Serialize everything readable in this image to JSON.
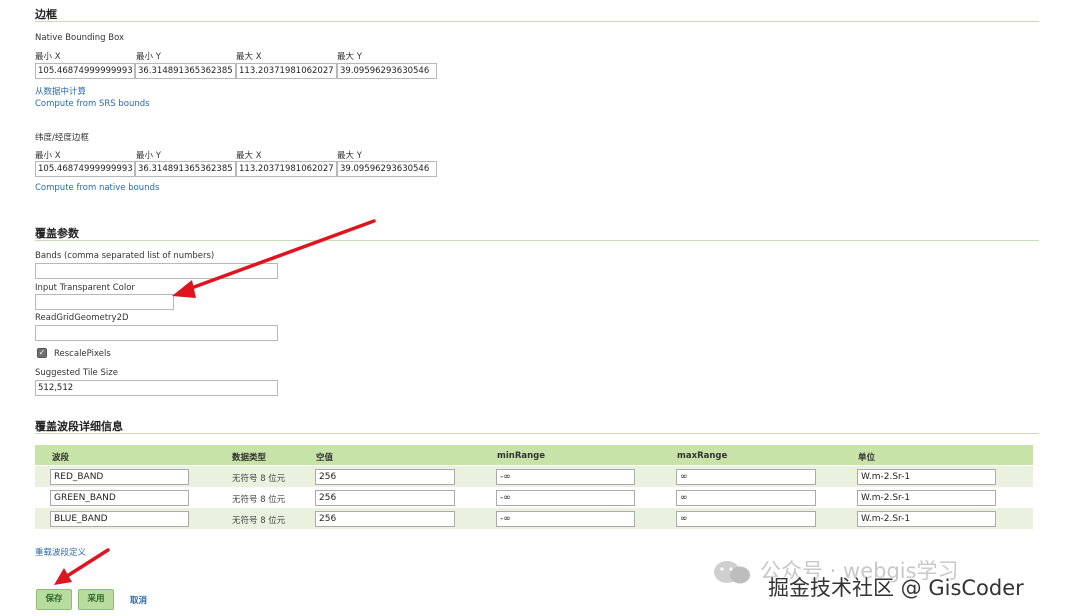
{
  "bbox_section": {
    "title": "边框",
    "native": {
      "label": "Native Bounding Box",
      "headers": [
        "最小 X",
        "最小 Y",
        "最大 X",
        "最大 Y"
      ],
      "values": [
        "105.46874999999993",
        "36.314891365362385",
        "113.20371981062027",
        "39.09596293630546"
      ],
      "link_compute_data": "从数据中计算",
      "link_compute_srs": "Compute from SRS bounds"
    },
    "latlon": {
      "label": "纬度/经度边框",
      "headers": [
        "最小 X",
        "最小 Y",
        "最大 X",
        "最大 Y"
      ],
      "values": [
        "105.46874999999993",
        "36.314891365362385",
        "113.20371981062027",
        "39.09596293630546"
      ],
      "link_compute_native": "Compute from native bounds"
    }
  },
  "coverage_params": {
    "title": "覆盖参数",
    "bands_label": "Bands (comma separated list of numbers)",
    "bands_value": "",
    "transparent_label": "Input Transparent Color",
    "transparent_value": "",
    "readgrid_label": "ReadGridGeometry2D",
    "readgrid_value": "",
    "rescale_label": "RescalePixels",
    "rescale_checked": true,
    "tile_size_label": "Suggested Tile Size",
    "tile_size_value": "512,512"
  },
  "band_details": {
    "title": "覆盖波段详细信息",
    "headers": [
      "波段",
      "数据类型",
      "空值",
      "minRange",
      "maxRange",
      "单位"
    ],
    "rows": [
      {
        "band": "RED_BAND",
        "type": "无符号 8 位元",
        "null": "256",
        "min": "-∞",
        "max": "∞",
        "unit": "W.m-2.Sr-1"
      },
      {
        "band": "GREEN_BAND",
        "type": "无符号 8 位元",
        "null": "256",
        "min": "-∞",
        "max": "∞",
        "unit": "W.m-2.Sr-1"
      },
      {
        "band": "BLUE_BAND",
        "type": "无符号 8 位元",
        "null": "256",
        "min": "-∞",
        "max": "∞",
        "unit": "W.m-2.Sr-1"
      }
    ],
    "reload_link": "重载波段定义"
  },
  "actions": {
    "save": "保存",
    "apply": "采用",
    "cancel": "取消"
  },
  "watermark": {
    "line1": "公众号 · webgis学习",
    "line2": "掘金技术社区 @ GisCoder"
  },
  "colors": {
    "accent_green": "#c8e3a8",
    "link_blue": "#2a6aa8",
    "arrow_red": "#e0141e"
  }
}
